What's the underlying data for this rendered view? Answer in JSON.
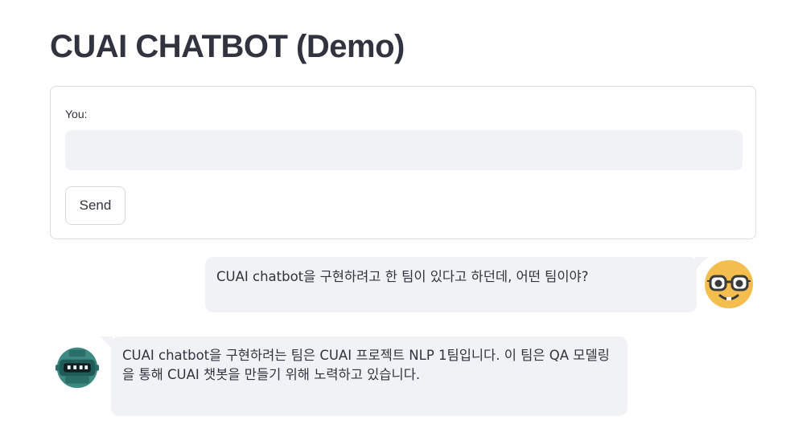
{
  "app": {
    "title": "CUAI CHATBOT (Demo)"
  },
  "form": {
    "input_label": "You:",
    "input_value": "",
    "send_label": "Send"
  },
  "messages": [
    {
      "role": "user",
      "avatar": "nerd-face-icon",
      "text": "CUAI chatbot을 구현하려고 한 팀이 있다고 하던데, 어떤 팀이야?"
    },
    {
      "role": "bot",
      "avatar": "robot-icon",
      "text": "CUAI chatbot을 구현하려는 팀은 CUAI 프로젝트 NLP 1팀입니다. 이 팀은 QA 모델링을 통해 CUAI 챗봇을 만들기 위해 노력하고 있습니다."
    }
  ],
  "colors": {
    "text": "#31333f",
    "bubble_bg": "#f0f2f6",
    "input_bg": "#f0f2f6",
    "border": "#dcdde2",
    "user_avatar": "#f4be4f",
    "bot_avatar": "#1f5c58"
  }
}
